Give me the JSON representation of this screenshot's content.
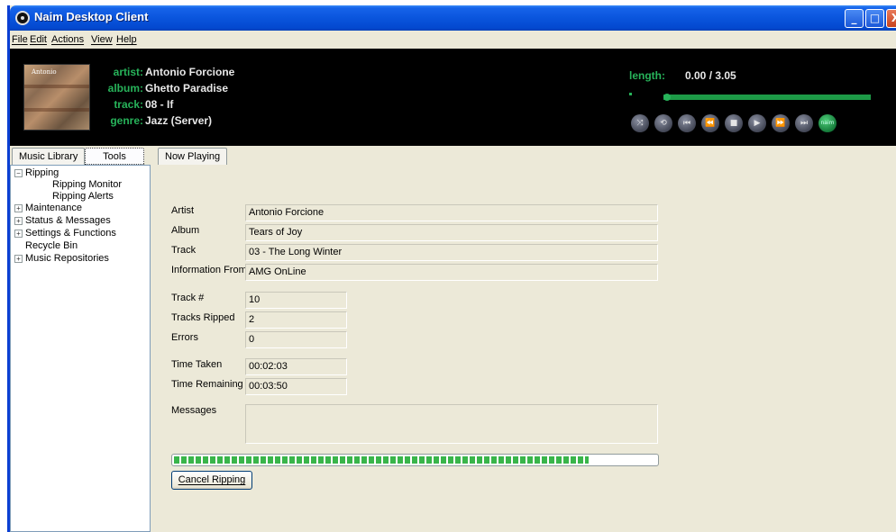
{
  "window": {
    "title": "Naim Desktop Client",
    "minimize": "_",
    "maximize": "□",
    "close": "X"
  },
  "menu": [
    "File",
    "Edit",
    "Actions",
    "View",
    "Help"
  ],
  "now_playing": {
    "album_art_text": "Antonio",
    "labels": {
      "artist": "artist:",
      "album": "album:",
      "track": "track:",
      "genre": "genre:",
      "length": "length:"
    },
    "artist": "Antonio Forcione",
    "album": "Ghetto Paradise",
    "track": "08 - If",
    "genre": "Jazz (Server)",
    "length": "0.00 / 3.05",
    "position_marker": ":",
    "playback_progress_fraction": 0.0
  },
  "controls": [
    {
      "name": "shuffle-icon",
      "glyph": "⤨"
    },
    {
      "name": "repeat-icon",
      "glyph": "⟲"
    },
    {
      "name": "skip-start-icon",
      "glyph": "⏮"
    },
    {
      "name": "rewind-icon",
      "glyph": "⏪"
    },
    {
      "name": "stop-icon",
      "glyph": "■"
    },
    {
      "name": "play-icon",
      "glyph": "▶"
    },
    {
      "name": "fast-forward-icon",
      "glyph": "⏩"
    },
    {
      "name": "skip-end-icon",
      "glyph": "⏭"
    },
    {
      "name": "naim-logo-icon",
      "glyph": "naim"
    }
  ],
  "tabs": {
    "music_library": "Music Library",
    "tools": "Tools",
    "now_playing": "Now Playing"
  },
  "tree": {
    "ripping": "Ripping",
    "ripping_monitor": "Ripping Monitor",
    "ripping_alerts": "Ripping Alerts",
    "maintenance": "Maintenance",
    "status_messages": "Status & Messages",
    "settings_functions": "Settings & Functions",
    "recycle_bin": "Recycle Bin",
    "music_repositories": "Music Repositories",
    "collapse": "−",
    "expand": "+"
  },
  "ripping_monitor": {
    "labels": {
      "artist": "Artist",
      "album": "Album",
      "track": "Track",
      "info_from": "Information From",
      "track_num": "Track #",
      "tracks_ripped": "Tracks Ripped",
      "errors": "Errors",
      "time_taken": "Time Taken",
      "time_remaining": "Time Remaining",
      "messages": "Messages"
    },
    "values": {
      "artist": "Antonio Forcione",
      "album": "Tears of Joy",
      "track": "03 - The Long Winter",
      "info_from": "AMG OnLine",
      "track_num": "10",
      "tracks_ripped": "2",
      "errors": "0",
      "time_taken": "00:02:03",
      "time_remaining": "00:03:50",
      "messages": ""
    },
    "rip_progress_fraction": 0.86,
    "cancel_label": "Cancel Ripping"
  }
}
